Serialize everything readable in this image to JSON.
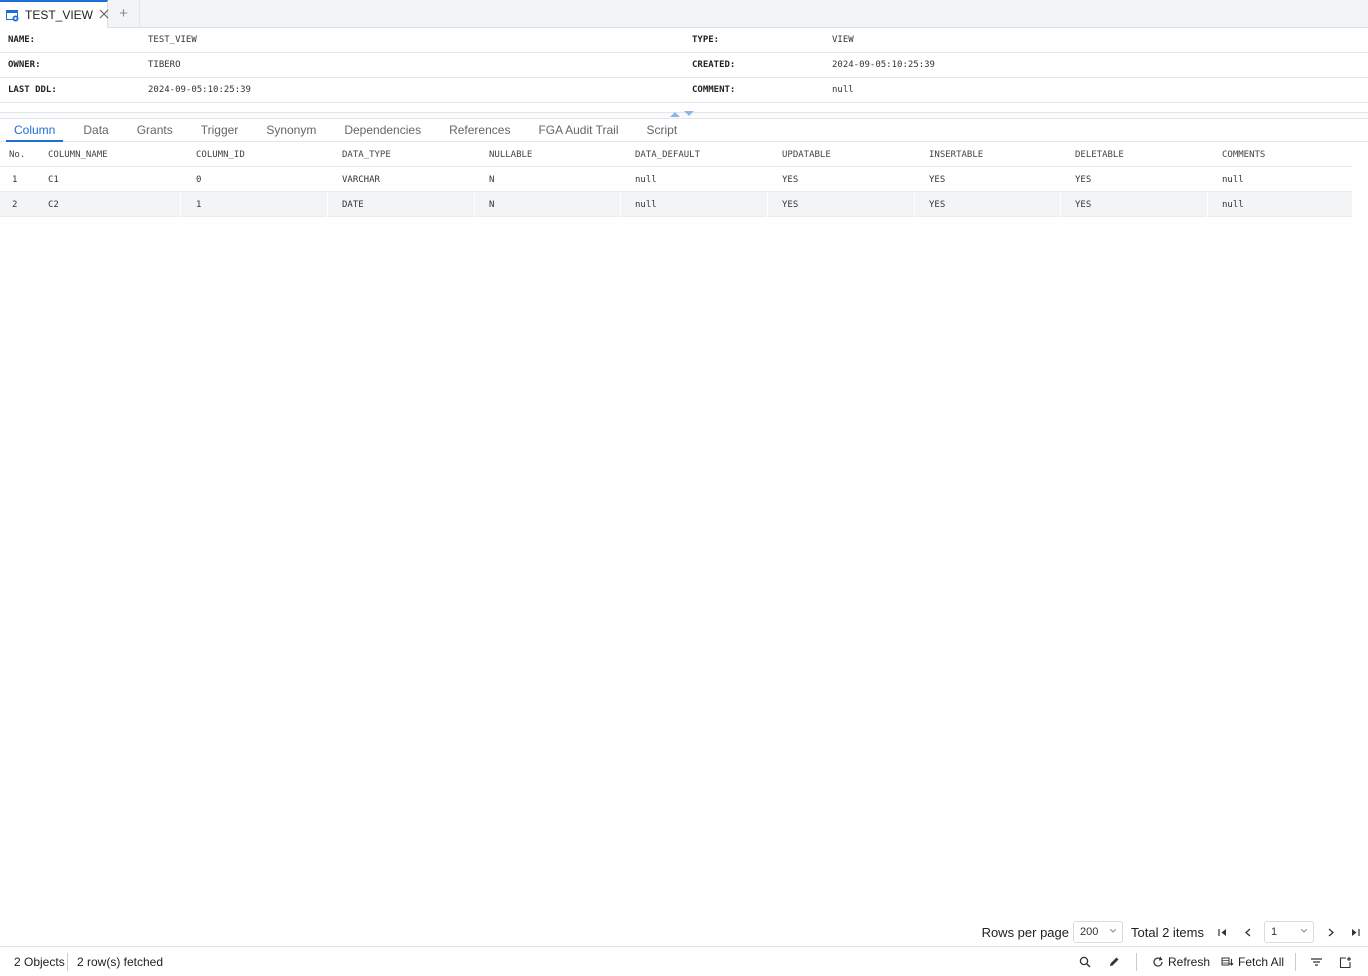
{
  "tab": {
    "title": "TEST_VIEW",
    "add_symbol": "+"
  },
  "info": {
    "name_label": "NAME:",
    "name_value": "TEST_VIEW",
    "type_label": "TYPE:",
    "type_value": "VIEW",
    "owner_label": "OWNER:",
    "owner_value": "TIBERO",
    "created_label": "CREATED:",
    "created_value": "2024-09-05:10:25:39",
    "lastddl_label": "LAST DDL:",
    "lastddl_value": "2024-09-05:10:25:39",
    "comment_label": "COMMENT:",
    "comment_value": "null"
  },
  "subtabs": [
    "Column",
    "Data",
    "Grants",
    "Trigger",
    "Synonym",
    "Dependencies",
    "References",
    "FGA Audit Trail",
    "Script"
  ],
  "active_subtab": "Column",
  "grid": {
    "columns": [
      "No.",
      "COLUMN_NAME",
      "COLUMN_ID",
      "DATA_TYPE",
      "NULLABLE",
      "DATA_DEFAULT",
      "UPDATABLE",
      "INSERTABLE",
      "DELETABLE",
      "COMMENTS"
    ],
    "rows": [
      [
        "1",
        "C1",
        "0",
        "VARCHAR",
        "N",
        "null",
        "YES",
        "YES",
        "YES",
        "null"
      ],
      [
        "2",
        "C2",
        "1",
        "DATE",
        "N",
        "null",
        "YES",
        "YES",
        "YES",
        "null"
      ]
    ]
  },
  "pager": {
    "rows_per_page_label": "Rows per page",
    "rows_per_page_value": "200",
    "total_label": "Total 2 items",
    "page_value": "1"
  },
  "status": {
    "objects": "2 Objects",
    "fetched": "2 row(s) fetched",
    "refresh_label": "Refresh",
    "fetch_all_label": "Fetch All"
  },
  "colors": {
    "accent": "#1d6fd6",
    "row_alt": "#f3f4f6",
    "border": "#e3e5e8"
  }
}
